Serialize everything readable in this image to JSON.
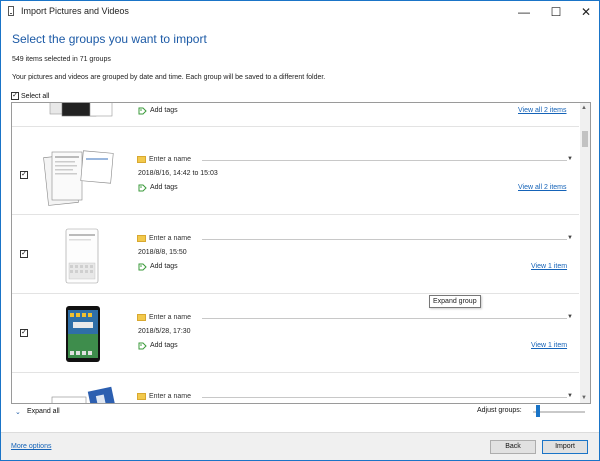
{
  "window": {
    "title": "Import Pictures and Videos",
    "controls": {
      "minimize": "—",
      "maximize": "☐",
      "close": "✕"
    }
  },
  "header": {
    "heading": "Select the groups you want to import",
    "selection_info": "549 items selected in 71 groups",
    "description": "Your pictures and videos are grouped by date and time. Each group will be saved to a different folder."
  },
  "select_all": {
    "label": "Select all",
    "checked": true
  },
  "groups": [
    {
      "name_placeholder": "Enter a name",
      "date": "",
      "add_tags": "Add tags",
      "view_link": "View all 2 items",
      "checked": true
    },
    {
      "name_placeholder": "Enter a name",
      "date": "2018/8/16, 14:42 to 15:03",
      "add_tags": "Add tags",
      "view_link": "View all 2 items",
      "checked": true
    },
    {
      "name_placeholder": "Enter a name",
      "date": "2018/8/8, 15:50",
      "add_tags": "Add tags",
      "view_link": "View 1 item",
      "checked": true
    },
    {
      "name_placeholder": "Enter a name",
      "date": "2018/5/28, 17:30",
      "add_tags": "Add tags",
      "view_link": "View 1 item",
      "checked": true
    },
    {
      "name_placeholder": "Enter a name",
      "date": "",
      "add_tags": "",
      "view_link": "",
      "checked": true
    }
  ],
  "tooltip": "Expand group",
  "bottom": {
    "expand_all": "Expand all",
    "adjust_groups": "Adjust groups:"
  },
  "footer": {
    "more_options": "More options",
    "back": "Back",
    "import": "Import"
  },
  "colors": {
    "accent": "#1a74c7",
    "heading": "#1c5aa6",
    "link": "#1563b8",
    "folder": "#f2c94c",
    "tag": "#3a9a3a"
  },
  "icons": {
    "folder": "folder-icon",
    "tag": "tag-icon",
    "checkbox": "checkbox-icon",
    "dropdown": "chevron-down-icon"
  }
}
